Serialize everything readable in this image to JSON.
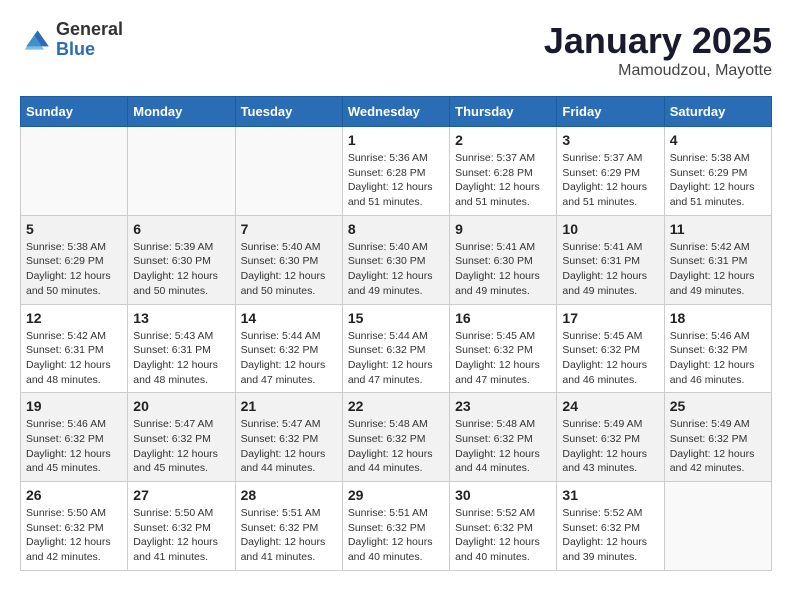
{
  "header": {
    "logo_general": "General",
    "logo_blue": "Blue",
    "month_title": "January 2025",
    "location": "Mamoudzou, Mayotte"
  },
  "days_of_week": [
    "Sunday",
    "Monday",
    "Tuesday",
    "Wednesday",
    "Thursday",
    "Friday",
    "Saturday"
  ],
  "weeks": [
    [
      {
        "day": null
      },
      {
        "day": null
      },
      {
        "day": null
      },
      {
        "day": 1,
        "sunrise": "5:36 AM",
        "sunset": "6:28 PM",
        "daylight": "12 hours and 51 minutes."
      },
      {
        "day": 2,
        "sunrise": "5:37 AM",
        "sunset": "6:28 PM",
        "daylight": "12 hours and 51 minutes."
      },
      {
        "day": 3,
        "sunrise": "5:37 AM",
        "sunset": "6:29 PM",
        "daylight": "12 hours and 51 minutes."
      },
      {
        "day": 4,
        "sunrise": "5:38 AM",
        "sunset": "6:29 PM",
        "daylight": "12 hours and 51 minutes."
      }
    ],
    [
      {
        "day": 5,
        "sunrise": "5:38 AM",
        "sunset": "6:29 PM",
        "daylight": "12 hours and 50 minutes."
      },
      {
        "day": 6,
        "sunrise": "5:39 AM",
        "sunset": "6:30 PM",
        "daylight": "12 hours and 50 minutes."
      },
      {
        "day": 7,
        "sunrise": "5:40 AM",
        "sunset": "6:30 PM",
        "daylight": "12 hours and 50 minutes."
      },
      {
        "day": 8,
        "sunrise": "5:40 AM",
        "sunset": "6:30 PM",
        "daylight": "12 hours and 49 minutes."
      },
      {
        "day": 9,
        "sunrise": "5:41 AM",
        "sunset": "6:30 PM",
        "daylight": "12 hours and 49 minutes."
      },
      {
        "day": 10,
        "sunrise": "5:41 AM",
        "sunset": "6:31 PM",
        "daylight": "12 hours and 49 minutes."
      },
      {
        "day": 11,
        "sunrise": "5:42 AM",
        "sunset": "6:31 PM",
        "daylight": "12 hours and 49 minutes."
      }
    ],
    [
      {
        "day": 12,
        "sunrise": "5:42 AM",
        "sunset": "6:31 PM",
        "daylight": "12 hours and 48 minutes."
      },
      {
        "day": 13,
        "sunrise": "5:43 AM",
        "sunset": "6:31 PM",
        "daylight": "12 hours and 48 minutes."
      },
      {
        "day": 14,
        "sunrise": "5:44 AM",
        "sunset": "6:32 PM",
        "daylight": "12 hours and 47 minutes."
      },
      {
        "day": 15,
        "sunrise": "5:44 AM",
        "sunset": "6:32 PM",
        "daylight": "12 hours and 47 minutes."
      },
      {
        "day": 16,
        "sunrise": "5:45 AM",
        "sunset": "6:32 PM",
        "daylight": "12 hours and 47 minutes."
      },
      {
        "day": 17,
        "sunrise": "5:45 AM",
        "sunset": "6:32 PM",
        "daylight": "12 hours and 46 minutes."
      },
      {
        "day": 18,
        "sunrise": "5:46 AM",
        "sunset": "6:32 PM",
        "daylight": "12 hours and 46 minutes."
      }
    ],
    [
      {
        "day": 19,
        "sunrise": "5:46 AM",
        "sunset": "6:32 PM",
        "daylight": "12 hours and 45 minutes."
      },
      {
        "day": 20,
        "sunrise": "5:47 AM",
        "sunset": "6:32 PM",
        "daylight": "12 hours and 45 minutes."
      },
      {
        "day": 21,
        "sunrise": "5:47 AM",
        "sunset": "6:32 PM",
        "daylight": "12 hours and 44 minutes."
      },
      {
        "day": 22,
        "sunrise": "5:48 AM",
        "sunset": "6:32 PM",
        "daylight": "12 hours and 44 minutes."
      },
      {
        "day": 23,
        "sunrise": "5:48 AM",
        "sunset": "6:32 PM",
        "daylight": "12 hours and 44 minutes."
      },
      {
        "day": 24,
        "sunrise": "5:49 AM",
        "sunset": "6:32 PM",
        "daylight": "12 hours and 43 minutes."
      },
      {
        "day": 25,
        "sunrise": "5:49 AM",
        "sunset": "6:32 PM",
        "daylight": "12 hours and 42 minutes."
      }
    ],
    [
      {
        "day": 26,
        "sunrise": "5:50 AM",
        "sunset": "6:32 PM",
        "daylight": "12 hours and 42 minutes."
      },
      {
        "day": 27,
        "sunrise": "5:50 AM",
        "sunset": "6:32 PM",
        "daylight": "12 hours and 41 minutes."
      },
      {
        "day": 28,
        "sunrise": "5:51 AM",
        "sunset": "6:32 PM",
        "daylight": "12 hours and 41 minutes."
      },
      {
        "day": 29,
        "sunrise": "5:51 AM",
        "sunset": "6:32 PM",
        "daylight": "12 hours and 40 minutes."
      },
      {
        "day": 30,
        "sunrise": "5:52 AM",
        "sunset": "6:32 PM",
        "daylight": "12 hours and 40 minutes."
      },
      {
        "day": 31,
        "sunrise": "5:52 AM",
        "sunset": "6:32 PM",
        "daylight": "12 hours and 39 minutes."
      },
      {
        "day": null
      }
    ]
  ]
}
